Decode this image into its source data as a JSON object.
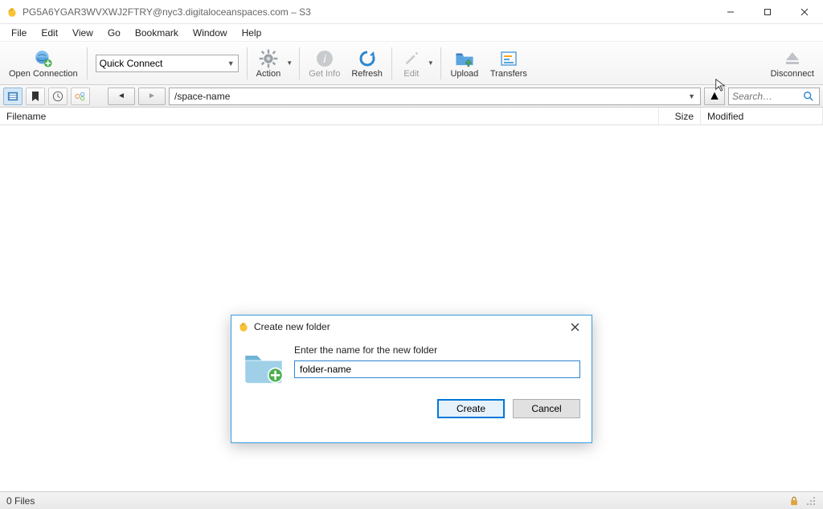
{
  "window": {
    "title": "PG5A6YGAR3WVXWJ2FTRY@nyc3.digitaloceanspaces.com – S3"
  },
  "menu": {
    "items": [
      "File",
      "Edit",
      "View",
      "Go",
      "Bookmark",
      "Window",
      "Help"
    ]
  },
  "toolbar": {
    "open_connection": "Open Connection",
    "quick_connect": "Quick Connect",
    "action": "Action",
    "get_info": "Get Info",
    "refresh": "Refresh",
    "edit": "Edit",
    "upload": "Upload",
    "transfers": "Transfers",
    "disconnect": "Disconnect"
  },
  "location": {
    "path": "/space-name",
    "search_placeholder": "Search…"
  },
  "columns": {
    "filename": "Filename",
    "size": "Size",
    "modified": "Modified"
  },
  "status": {
    "text": "0 Files"
  },
  "dialog": {
    "title": "Create new folder",
    "prompt": "Enter the name for the new folder",
    "value": "folder-name",
    "create": "Create",
    "cancel": "Cancel"
  }
}
